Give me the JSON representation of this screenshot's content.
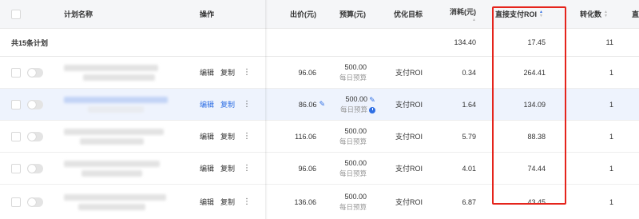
{
  "header": {
    "plan_name": "计划名称",
    "operation": "操作",
    "bid": "出价(元)",
    "budget": "预算(元)",
    "goal": "优化目标",
    "cost": "消耗(元)",
    "roi": "直接支付ROI",
    "conversions": "转化数",
    "cutoff": "直"
  },
  "summary": {
    "label": "共15条计划",
    "cost": "134.40",
    "roi": "17.45",
    "conversions": "11"
  },
  "actions": {
    "edit": "编辑",
    "copy": "复制",
    "more": "⋮"
  },
  "rows": [
    {
      "bid": "96.06",
      "budget": "500.00",
      "budget_sub": "每日预算",
      "goal": "支付ROI",
      "cost": "0.34",
      "roi": "264.41",
      "conversions": "1"
    },
    {
      "bid": "86.06",
      "budget": "500.00",
      "budget_sub": "每日预算",
      "goal": "支付ROI",
      "cost": "1.64",
      "roi": "134.09",
      "conversions": "1"
    },
    {
      "bid": "116.06",
      "budget": "500.00",
      "budget_sub": "每日预算",
      "goal": "支付ROI",
      "cost": "5.79",
      "roi": "88.38",
      "conversions": "1"
    },
    {
      "bid": "96.06",
      "budget": "500.00",
      "budget_sub": "每日预算",
      "goal": "支付ROI",
      "cost": "4.01",
      "roi": "74.44",
      "conversions": "1"
    },
    {
      "bid": "136.06",
      "budget": "500.00",
      "budget_sub": "每日预算",
      "goal": "支付ROI",
      "cost": "6.87",
      "roi": "43.45",
      "conversions": "1"
    }
  ],
  "colors": {
    "accent": "#2f6fe4",
    "highlight_box": "#e5241c",
    "row_highlight": "#eef3fd"
  }
}
